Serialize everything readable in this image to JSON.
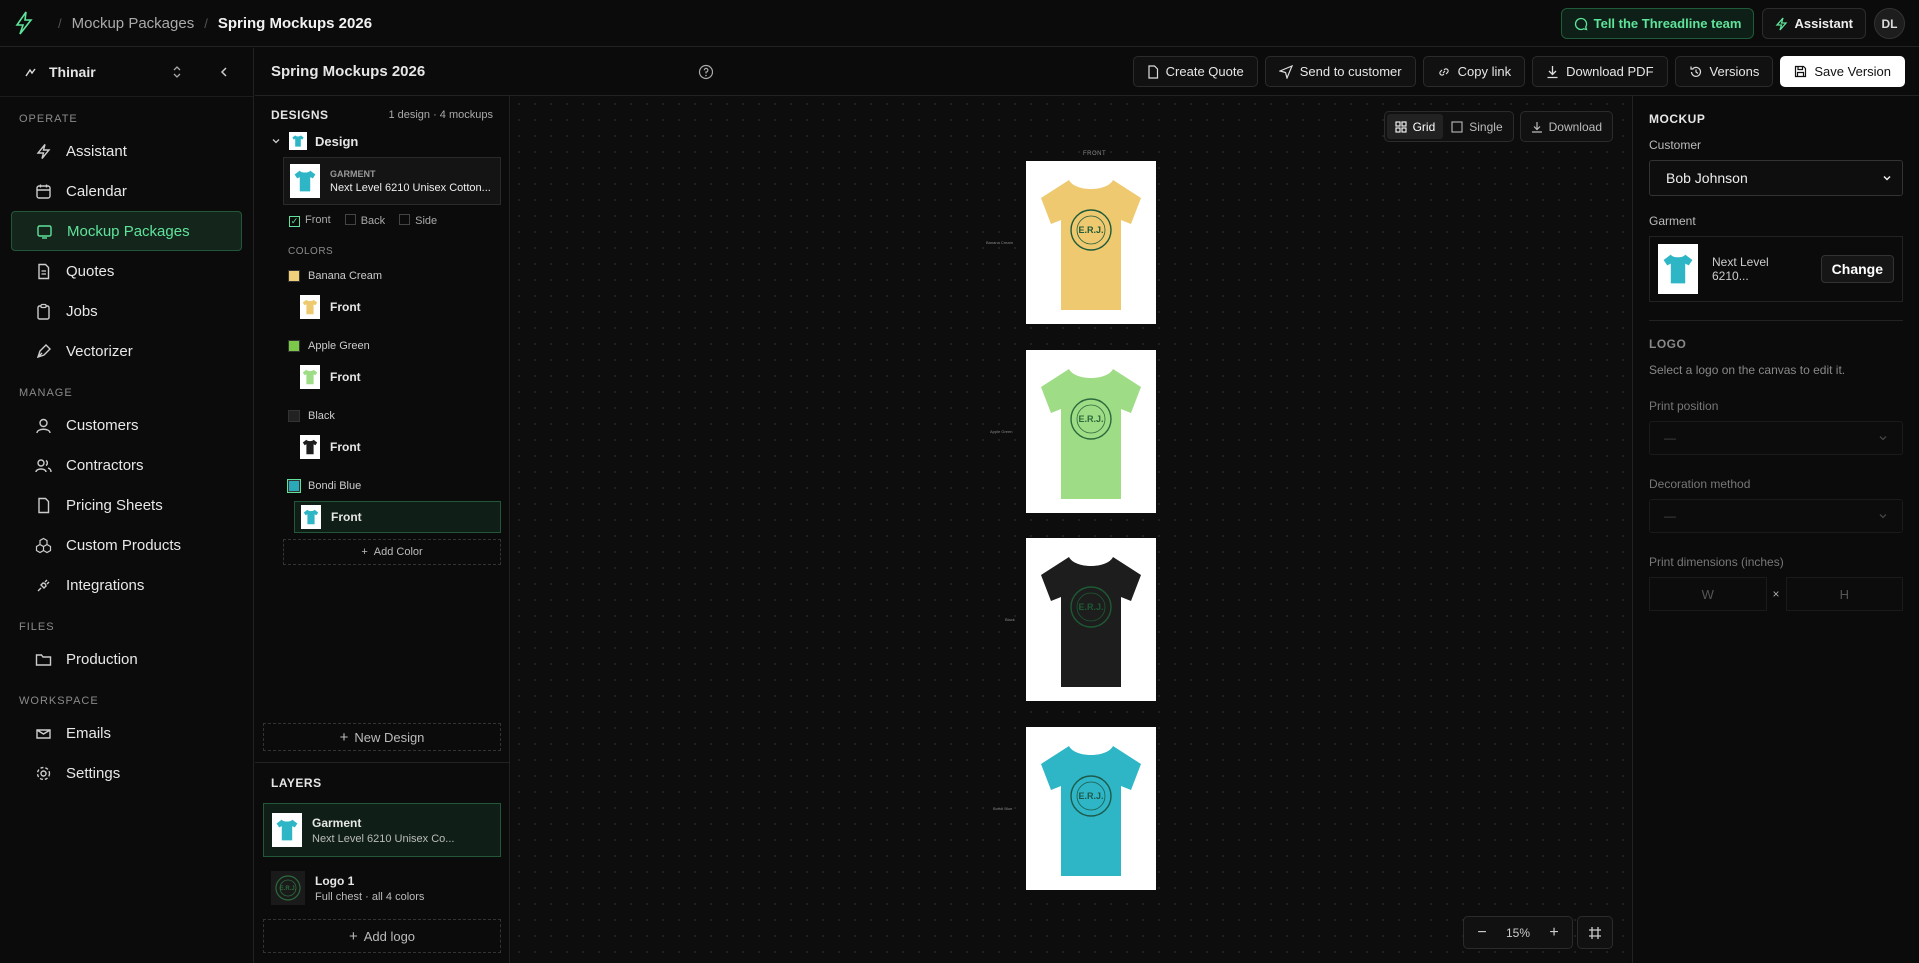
{
  "topbar": {
    "breadcrumb": [
      "Mockup Packages",
      "Spring Mockups 2026"
    ],
    "feedback_label": "Tell the Threadline team",
    "assistant_label": "Assistant",
    "avatar_initials": "DL"
  },
  "sidebar": {
    "workspace": "Thinair",
    "sections": {
      "operate": "OPERATE",
      "manage": "MANAGE",
      "files": "FILES",
      "workspace": "WORKSPACE"
    },
    "items": [
      {
        "label": "Assistant",
        "icon": "lightning-icon"
      },
      {
        "label": "Calendar",
        "icon": "calendar-icon"
      },
      {
        "label": "Mockup Packages",
        "icon": "screen-icon",
        "active": true
      },
      {
        "label": "Quotes",
        "icon": "document-icon"
      },
      {
        "label": "Jobs",
        "icon": "clipboard-icon"
      },
      {
        "label": "Vectorizer",
        "icon": "pen-icon"
      },
      {
        "label": "Customers",
        "icon": "user-icon"
      },
      {
        "label": "Contractors",
        "icon": "users-icon"
      },
      {
        "label": "Pricing Sheets",
        "icon": "file-icon"
      },
      {
        "label": "Custom Products",
        "icon": "cubes-icon"
      },
      {
        "label": "Integrations",
        "icon": "plug-icon"
      },
      {
        "label": "Production",
        "icon": "folder-icon"
      },
      {
        "label": "Emails",
        "icon": "mail-icon"
      },
      {
        "label": "Settings",
        "icon": "gear-icon"
      }
    ]
  },
  "subbar": {
    "title": "Spring Mockups 2026",
    "actions": [
      "Create Quote",
      "Send to customer",
      "Copy link",
      "Download PDF",
      "Versions",
      "Save Version"
    ]
  },
  "designs": {
    "header": "DESIGNS",
    "count": "1 design · 4 mockups",
    "design_name": "Design",
    "garment_label": "GARMENT",
    "garment_name": "Next Level 6210 Unisex Cotton...",
    "sides": [
      "Front",
      "Back",
      "Side"
    ],
    "colors_header": "COLORS",
    "colors": [
      {
        "name": "Banana Cream",
        "hex": "#f0cf7b",
        "view": "Front"
      },
      {
        "name": "Apple Green",
        "hex": "#7cc94a",
        "view": "Front"
      },
      {
        "name": "Black",
        "hex": "#222222",
        "view": "Front"
      },
      {
        "name": "Bondi Blue",
        "hex": "#2aa9b8",
        "view": "Front"
      }
    ],
    "add_color": "Add Color",
    "new_design": "New Design"
  },
  "layers": {
    "header": "LAYERS",
    "items": [
      {
        "title": "Garment",
        "subtitle": "Next Level 6210 Unisex Co..."
      },
      {
        "title": "Logo 1",
        "subtitle": "Full chest · all 4 colors"
      }
    ],
    "add_logo": "Add logo"
  },
  "canvas": {
    "view_grid": "Grid",
    "view_single": "Single",
    "download": "Download",
    "front_label": "FRONT",
    "zoom": "15%",
    "logo_text": "E.R.J.",
    "mockups": [
      {
        "label": "Banana Cream",
        "shirt": "#eec96f",
        "ink": "#1e5a3a"
      },
      {
        "label": "Apple Green",
        "shirt": "#9fdc86",
        "ink": "#2b6a3c"
      },
      {
        "label": "Black",
        "shirt": "#1d1d1d",
        "ink": "#1d5a34"
      },
      {
        "label": "Bondi Blue",
        "shirt": "#2eb6c7",
        "ink": "#1e5a4a"
      }
    ]
  },
  "inspector": {
    "header": "MOCKUP",
    "customer_label": "Customer",
    "customer_value": "Bob Johnson",
    "garment_label": "Garment",
    "garment_name": "Next Level 6210...",
    "change_label": "Change",
    "logo_header": "LOGO",
    "logo_hint": "Select a logo on the canvas to edit it.",
    "print_position_label": "Print position",
    "print_position_value": "—",
    "decoration_label": "Decoration method",
    "decoration_value": "—",
    "dimensions_label": "Print dimensions (inches)",
    "w_placeholder": "W",
    "h_placeholder": "H",
    "times": "×"
  }
}
